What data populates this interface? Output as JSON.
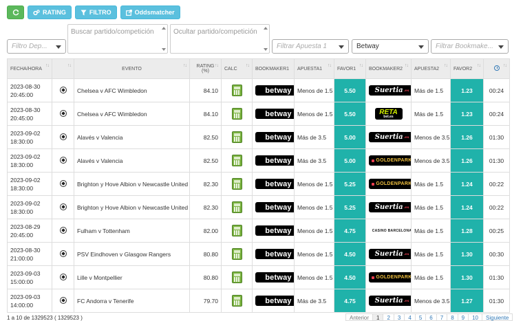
{
  "toolbar": {
    "refresh_icon": "refresh-icon",
    "rating_label": "RATING",
    "rating_icon": "gears-icon",
    "filtro_label": "FILTRO",
    "filtro_icon": "filter-icon",
    "oddsmatcher_label": "Oddsmatcher",
    "oddsmatcher_icon": "external-link-icon",
    "green": "#5cb85c",
    "blue": "#5bc0de"
  },
  "filters": {
    "deporte_placeholder": "Filtro Dep...",
    "buscar_placeholder": "Buscar partido/competición",
    "ocultar_placeholder": "Ocultar partido/competición",
    "apuesta_placeholder": "Filtrar Apuesta 1",
    "bookmaker1_value": "Betway",
    "bookmaker2_placeholder": "Filtrar Bookmake..."
  },
  "table": {
    "headers": {
      "fecha": "FECHA/HORA",
      "evento": "EVENTO",
      "rating": "RATING (%)",
      "calc": "CALC",
      "bookmaker1": "BOOKMAKER1",
      "apuesta1": "APUESTA1",
      "favor1": "FAVOR1",
      "bookmaker2": "BOOKMAKER2",
      "apuesta2": "APUESTA2",
      "favor2": "FAVOR2"
    },
    "favor_color": "#20b2aa",
    "rows": [
      {
        "date": "2023-08-30",
        "time": "20:45:00",
        "event": "Chelsea v AFC Wimbledon",
        "rating": "84.10",
        "bm1": "betway",
        "apuesta1": "Menos de 1.5",
        "favor1": "5.50",
        "bm2": "suertia",
        "apuesta2": "Más de 1.5",
        "favor2": "1.23",
        "countdown": "00:24"
      },
      {
        "date": "2023-08-30",
        "time": "20:45:00",
        "event": "Chelsea v AFC Wimbledon",
        "rating": "84.10",
        "bm1": "betway",
        "apuesta1": "Menos de 1.5",
        "favor1": "5.50",
        "bm2": "retabet",
        "apuesta2": "Más de 1.5",
        "favor2": "1.23",
        "countdown": "00:24"
      },
      {
        "date": "2023-09-02",
        "time": "18:30:00",
        "event": "Alavés v Valencia",
        "rating": "82.50",
        "bm1": "betway",
        "apuesta1": "Más de 3.5",
        "favor1": "5.00",
        "bm2": "suertia",
        "apuesta2": "Menos de 3.5",
        "favor2": "1.26",
        "countdown": "01:30"
      },
      {
        "date": "2023-09-02",
        "time": "18:30:00",
        "event": "Alavés v Valencia",
        "rating": "82.50",
        "bm1": "betway",
        "apuesta1": "Más de 3.5",
        "favor1": "5.00",
        "bm2": "goldenpark",
        "apuesta2": "Menos de 3.5",
        "favor2": "1.26",
        "countdown": "01:30"
      },
      {
        "date": "2023-09-02",
        "time": "18:30:00",
        "event": "Brighton y Hove Albion v Newcastle United",
        "rating": "82.30",
        "bm1": "betway",
        "apuesta1": "Menos de 1.5",
        "favor1": "5.25",
        "bm2": "goldenpark",
        "apuesta2": "Más de 1.5",
        "favor2": "1.24",
        "countdown": "00:22"
      },
      {
        "date": "2023-09-02",
        "time": "18:30:00",
        "event": "Brighton y Hove Albion v Newcastle United",
        "rating": "82.30",
        "bm1": "betway",
        "apuesta1": "Menos de 1.5",
        "favor1": "5.25",
        "bm2": "suertia",
        "apuesta2": "Más de 1.5",
        "favor2": "1.24",
        "countdown": "00:22"
      },
      {
        "date": "2023-08-29",
        "time": "20:45:00",
        "event": "Fulham v Tottenham",
        "rating": "82.00",
        "bm1": "betway",
        "apuesta1": "Menos de 1.5",
        "favor1": "4.75",
        "bm2": "casino",
        "apuesta2": "Más de 1.5",
        "favor2": "1.28",
        "countdown": "00:25"
      },
      {
        "date": "2023-08-30",
        "time": "21:00:00",
        "event": "PSV Eindhoven v Glasgow Rangers",
        "rating": "80.80",
        "bm1": "betway",
        "apuesta1": "Menos de 1.5",
        "favor1": "4.50",
        "bm2": "suertia",
        "apuesta2": "Más de 1.5",
        "favor2": "1.30",
        "countdown": "00:30"
      },
      {
        "date": "2023-09-03",
        "time": "15:00:00",
        "event": "Lille v Montpellier",
        "rating": "80.80",
        "bm1": "betway",
        "apuesta1": "Menos de 1.5",
        "favor1": "4.50",
        "bm2": "goldenpark",
        "apuesta2": "Más de 1.5",
        "favor2": "1.30",
        "countdown": "01:30"
      },
      {
        "date": "2023-09-03",
        "time": "14:00:00",
        "event": "FC Andorra v Tenerife",
        "rating": "79.70",
        "bm1": "betway",
        "apuesta1": "Más de 3.5",
        "favor1": "4.75",
        "bm2": "suertia",
        "apuesta2": "Menos de 3.5",
        "favor2": "1.27",
        "countdown": "01:30"
      }
    ]
  },
  "logos": {
    "betway": {
      "text": "betway"
    },
    "suertia": {
      "text": "Suertia",
      "suffix": ".es"
    },
    "goldenpark": {
      "text": "GOLDENPARK"
    },
    "retabet": {
      "text": "RETA",
      "suffix": "bet.es"
    },
    "casino": {
      "text": "CASINO BARCELONA"
    }
  },
  "footer": {
    "info": "1 a 10 de 1329523 ( 1329523 )",
    "prev": "Anterior",
    "pages": [
      "1",
      "2",
      "3",
      "4",
      "5",
      "6",
      "7",
      "8",
      "9",
      "10"
    ],
    "next": "Siguiente"
  }
}
